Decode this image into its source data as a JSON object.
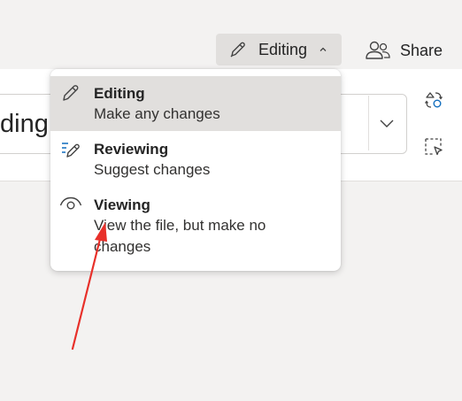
{
  "toolbar": {
    "mode_button_label": "Editing",
    "share_button_label": "Share"
  },
  "ribbon": {
    "style_gallery_text": "ding"
  },
  "mode_menu": {
    "items": [
      {
        "title": "Editing",
        "description": "Make any changes",
        "icon": "pencil-icon",
        "selected": true
      },
      {
        "title": "Reviewing",
        "description": "Suggest changes",
        "icon": "review-pencil-icon",
        "selected": false
      },
      {
        "title": "Viewing",
        "description": "View the file, but make no changes",
        "icon": "eye-icon",
        "selected": false
      }
    ]
  },
  "annotation": {
    "arrow_color": "#e8302a"
  },
  "colors": {
    "accent_blue": "#0f6cbd",
    "selected_bg": "#e1dfdd"
  }
}
